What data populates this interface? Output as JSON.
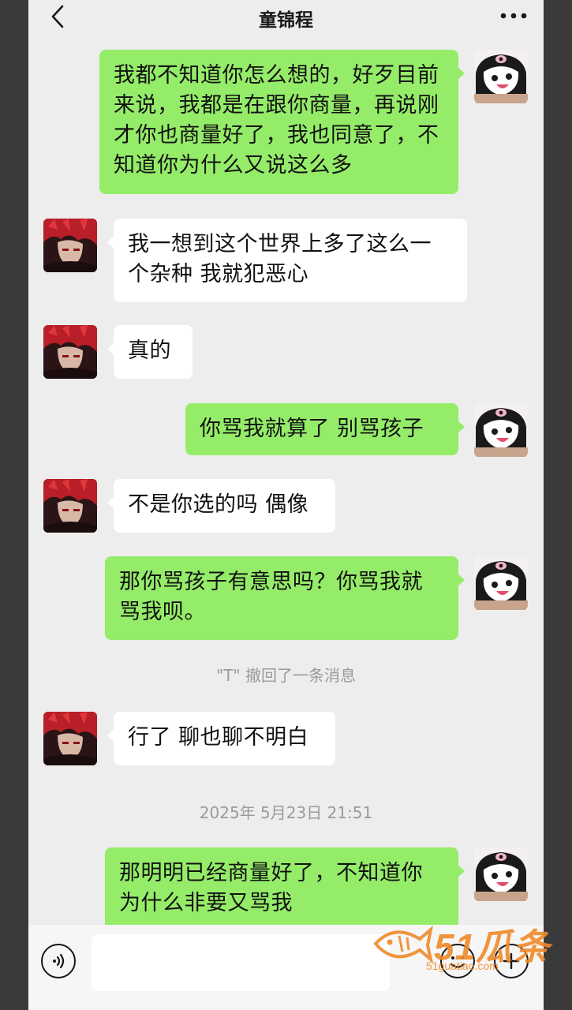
{
  "header": {
    "title": "童锦程"
  },
  "messages": [
    {
      "side": "right",
      "text": "我都不知道你怎么想的，好歹目前来说，我都是在跟你商量，再说刚才你也商量好了，我也同意了，不知道你为什么又说这么多"
    },
    {
      "side": "left",
      "text": "我一想到这个世界上多了这么一个杂种 我就犯恶心"
    },
    {
      "side": "left",
      "text": "真的"
    },
    {
      "side": "right",
      "text": "你骂我就算了 别骂孩子"
    },
    {
      "side": "left",
      "text": "不是你选的吗 偶像"
    },
    {
      "side": "right",
      "text": "那你骂孩子有意思吗？你骂我就骂我呗。"
    },
    {
      "side": "system",
      "text": "\"T\" 撤回了一条消息"
    },
    {
      "side": "left",
      "text": "行了 聊也聊不明白"
    },
    {
      "side": "system",
      "text": "2025年 5月23日 21:51"
    },
    {
      "side": "right",
      "text": "那明明已经商量好了，不知道你为什么非要又骂我"
    }
  ],
  "input": {
    "value": "",
    "placeholder": ""
  },
  "watermark": {
    "brand": "51瓜条",
    "url": "51guatiao.com"
  },
  "colors": {
    "background": "#ededed",
    "bubble_self": "#95ec69",
    "bubble_other": "#ffffff",
    "watermark": "#f08a2a"
  },
  "icons": {
    "back": "chevron-left-icon",
    "more": "more-dots-icon",
    "voice": "voice-icon",
    "emoji": "emoji-icon",
    "plus": "plus-icon"
  }
}
